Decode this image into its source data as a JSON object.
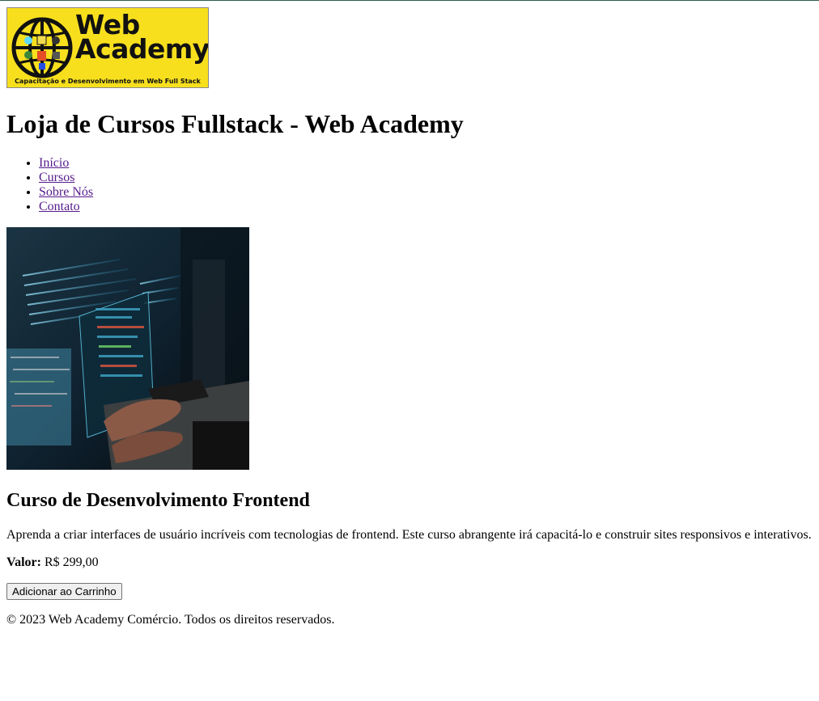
{
  "logo": {
    "line1": "Web",
    "line2": "Academy",
    "tagline": "Capacitação e Desenvolvimento em Web Full Stack",
    "brand_color": "#f7df1e"
  },
  "header": {
    "title": "Loja de Cursos Fullstack - Web Academy"
  },
  "nav": {
    "items": [
      {
        "label": "Início"
      },
      {
        "label": "Cursos"
      },
      {
        "label": "Sobre Nós"
      },
      {
        "label": "Contato"
      }
    ]
  },
  "product": {
    "image_icon": "course-photo-coding-laptop",
    "title": "Curso de Desenvolvimento Frontend",
    "description": "Aprenda a criar interfaces de usuário incríveis com tecnologias de frontend. Este curso abrangente irá capacitá-lo e construir sites responsivos e interativos.",
    "price_label": "Valor:",
    "price_value": " R$ 299,00",
    "add_button": "Adicionar ao Carrinho"
  },
  "footer": {
    "copyright": "© 2023 Web Academy Comércio. Todos os direitos reservados."
  }
}
